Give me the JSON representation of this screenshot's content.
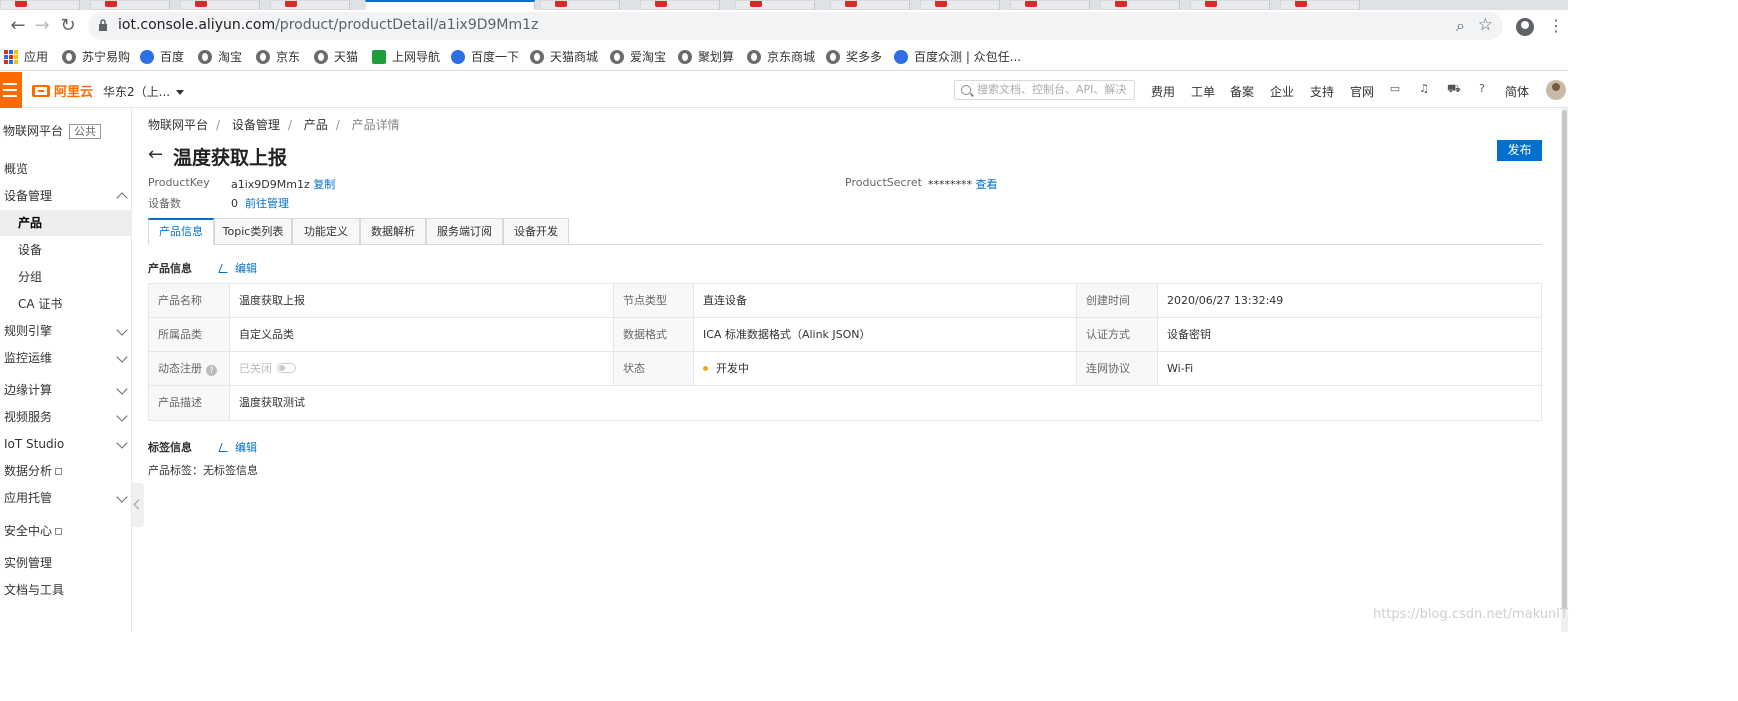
{
  "browser": {
    "url_domain": "iot.console.aliyun.com",
    "url_path": "/product/productDetail/a1ix9D9Mm1z",
    "bookmarks": [
      "应用",
      "苏宁易购",
      "百度",
      "淘宝",
      "京东",
      "天猫",
      "上网导航",
      "百度一下",
      "天猫商城",
      "爱淘宝",
      "聚划算",
      "京东商城",
      "奖多多",
      "百度众测 | 众包任..."
    ]
  },
  "topbar": {
    "logo": "阿里云",
    "region": "华东2（上...",
    "search_placeholder": "搜索文档、控制台、API、解决",
    "nav": [
      "费用",
      "工单",
      "备案",
      "企业",
      "支持",
      "官网"
    ],
    "lang": "简体"
  },
  "sidebar": {
    "title": "物联网平台",
    "badge": "公共",
    "items": [
      "概览",
      "设备管理",
      "产品",
      "设备",
      "分组",
      "CA 证书",
      "规则引擎",
      "监控运维",
      "边缘计算",
      "视频服务",
      "IoT Studio",
      "数据分析",
      "应用托管",
      "安全中心",
      "实例管理",
      "文档与工具"
    ]
  },
  "breadcrumb": [
    "物联网平台",
    "设备管理",
    "产品",
    "产品详情"
  ],
  "page": {
    "title": "温度获取上报",
    "publish": "发布",
    "product_key_label": "ProductKey",
    "product_key": "a1ix9D9Mm1z",
    "copy": "复制",
    "device_count_label": "设备数",
    "device_count": "0",
    "manage": "前往管理",
    "secret_label": "ProductSecret",
    "secret_value": "********",
    "view": "查看"
  },
  "tabs": [
    "产品信息",
    "Topic类列表",
    "功能定义",
    "数据解析",
    "服务端订阅",
    "设备开发"
  ],
  "info": {
    "section": "产品信息",
    "edit": "编辑",
    "rows": [
      [
        [
          "产品名称",
          "温度获取上报"
        ],
        [
          "节点类型",
          "直连设备"
        ],
        [
          "创建时间",
          "2020/06/27 13:32:49"
        ]
      ],
      [
        [
          "所属品类",
          "自定义品类"
        ],
        [
          "数据格式",
          "ICA 标准数据格式（Alink JSON）"
        ],
        [
          "认证方式",
          "设备密钥"
        ]
      ],
      [
        [
          "动态注册",
          "已关闭"
        ],
        [
          "状态",
          "开发中"
        ],
        [
          "连网协议",
          "Wi-Fi"
        ]
      ],
      [
        [
          "产品描述",
          "温度获取测试"
        ]
      ]
    ]
  },
  "tags": {
    "section": "标签信息",
    "edit": "编辑",
    "label": "产品标签：",
    "value": "无标签信息"
  },
  "watermark": "https://blog.csdn.net/makunIT",
  "colors": {
    "accent": "#0070cc",
    "brand": "#ff6a00",
    "status_dev": "#f5a623"
  }
}
